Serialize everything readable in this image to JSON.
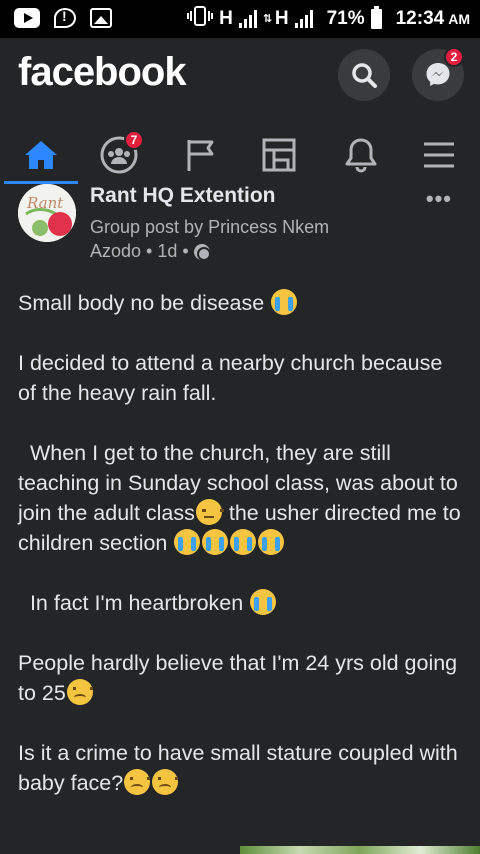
{
  "status_bar": {
    "network1": "H",
    "network2": "H",
    "battery": "71%",
    "time": "12:34",
    "ampm": "AM",
    "icons": [
      "youtube-icon",
      "messenger-notification-icon",
      "image-icon",
      "vibrate-icon",
      "signal-icon",
      "battery-icon"
    ]
  },
  "header": {
    "logo": "facebook",
    "search_icon": "search-icon",
    "messenger_icon": "messenger-icon",
    "messenger_badge": "2"
  },
  "tabs": [
    {
      "name": "home",
      "icon": "home-icon",
      "active": true
    },
    {
      "name": "groups",
      "icon": "groups-icon",
      "badge": "7"
    },
    {
      "name": "pages",
      "icon": "flag-icon"
    },
    {
      "name": "watch",
      "icon": "watch-icon"
    },
    {
      "name": "notifications",
      "icon": "bell-icon"
    },
    {
      "name": "menu",
      "icon": "menu-icon"
    }
  ],
  "post": {
    "group_name": "Rant HQ Extention",
    "posted_by": "Group post by Princess Nkem",
    "author_last": "Azodo",
    "time": "1d",
    "separator": "•",
    "paragraphs": {
      "p1": "Small body no be disease ",
      "p2": "I decided to attend a nearby church because of the heavy rain fall.",
      "p3a": "  When I get to the church, they are still teaching in Sunday school class, was about to join the adult class",
      "p3b": " the usher directed me to children section ",
      "p4": "  In fact I'm heartbroken ",
      "p5": "People hardly believe that I'm 24 yrs old going to 25",
      "p6": "Is it a crime to have small stature coupled with baby face?"
    }
  },
  "colors": {
    "background": "#242526",
    "accent": "#2d88ff",
    "badge": "#e41e3f",
    "text": "#e4e6eb",
    "secondary_text": "#b0b3b8"
  }
}
